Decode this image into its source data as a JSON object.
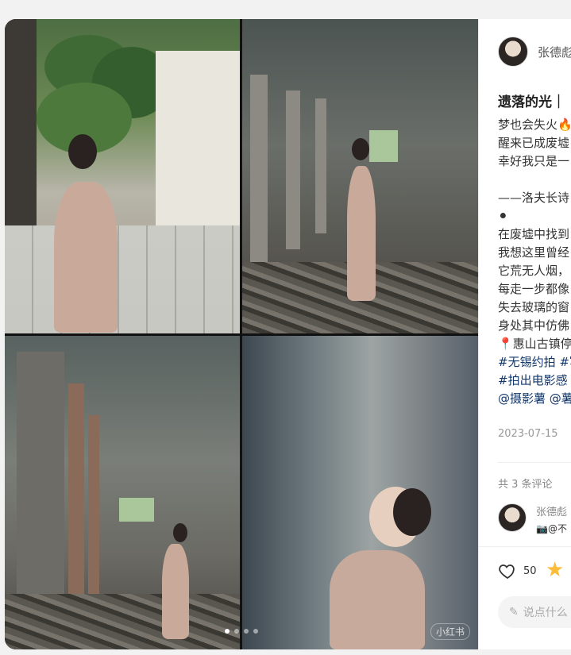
{
  "author": {
    "name": "张德彪"
  },
  "note": {
    "title": "遗落的光｜",
    "description_lines": [
      "梦也会失火🔥",
      "醒来已成废墟",
      "幸好我只是一",
      "",
      "——洛夫长诗",
      "⚫",
      "在废墟中找到",
      "我想这里曾经",
      "它荒无人烟，",
      "每走一步都像",
      "失去玻璃的窗",
      "身处其中仿佛"
    ],
    "location": "📍惠山古镇停",
    "tags_line1": "#无锡约拍 #写",
    "tags_line2": "#拍出电影感",
    "mentions": "@摄影薯 @薯",
    "date": "2023-07-15"
  },
  "comments": {
    "count_label": "共 3 条评论",
    "items": [
      {
        "name": "张德彪",
        "text": "📷@不"
      }
    ]
  },
  "actions": {
    "like_count": "50",
    "comment_placeholder": "说点什么"
  },
  "carousel": {
    "total": 4,
    "active": 0,
    "watermark": "小红书"
  },
  "colors": {
    "tag": "#13386c",
    "star": "#fdbc38",
    "background": "#f2f2f2"
  }
}
